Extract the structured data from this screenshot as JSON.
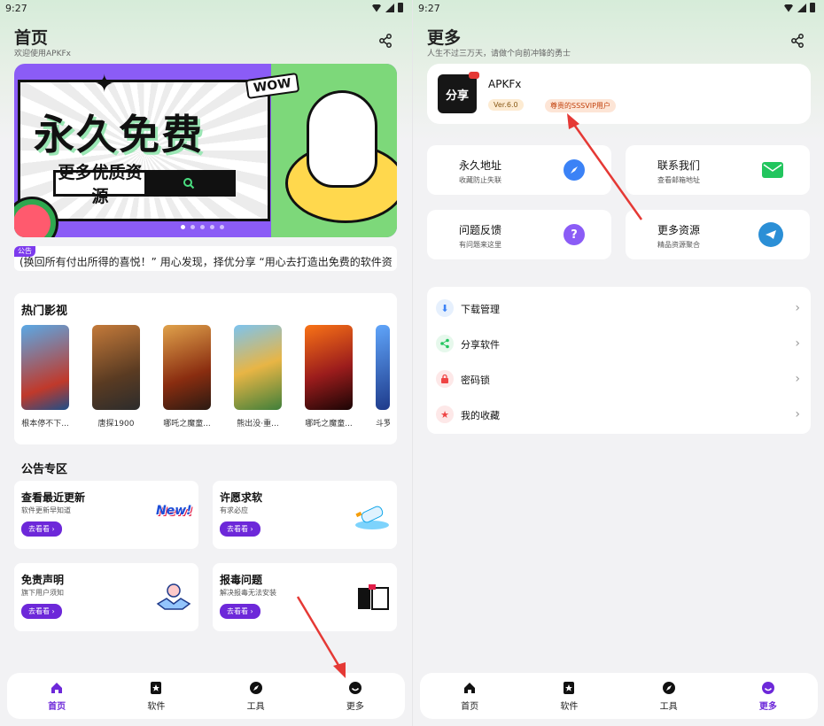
{
  "left_screen": {
    "status": {
      "time": "9:27"
    },
    "header": {
      "title": "首页",
      "subtitle": "欢迎使用APKFx"
    },
    "banner": {
      "title": "永久免费",
      "search_text": "更多优质资源",
      "wow": "WOW",
      "dots": 5,
      "active_dot": 0
    },
    "notice": {
      "tag": "公告",
      "text": "(换回所有付出所得的喜悦！” 用心发现，择优分享 “用心去打造出免费的软件资"
    },
    "movies": {
      "title": "热门影视",
      "items": [
        {
          "name": "根本停不下...",
          "color": "#2b6cb0"
        },
        {
          "name": "唐探1900",
          "color": "#a0522d"
        },
        {
          "name": "哪吒之魔童...",
          "color": "#7c2d12"
        },
        {
          "name": "熊出没·重...",
          "color": "#2f855a"
        },
        {
          "name": "哪吒之魔童...",
          "color": "#9b1c1c"
        },
        {
          "name": "斗罗",
          "color": "#1e3a8a"
        }
      ]
    },
    "notice_zone": {
      "title": "公告专区",
      "cards": [
        {
          "title": "查看最近更新",
          "sub": "软件更新早知道",
          "btn": "去看看"
        },
        {
          "title": "许愿求软",
          "sub": "有求必应",
          "btn": "去看看"
        },
        {
          "title": "免责声明",
          "sub": "旗下用户须知",
          "btn": "去看看"
        },
        {
          "title": "报毒问题",
          "sub": "解决报毒无法安装",
          "btn": "去看看"
        }
      ],
      "art_text": {
        "new": "New!"
      }
    },
    "tabbar": [
      {
        "label": "首页",
        "icon": "home-icon",
        "active": true
      },
      {
        "label": "软件",
        "icon": "star-icon",
        "active": false
      },
      {
        "label": "工具",
        "icon": "compass-icon",
        "active": false
      },
      {
        "label": "更多",
        "icon": "more-icon",
        "active": false
      }
    ]
  },
  "right_screen": {
    "status": {
      "time": "9:27"
    },
    "header": {
      "title": "更多",
      "subtitle": "人生不过三万天，请做个向前冲锋的勇士"
    },
    "profile": {
      "logo_text": "分享",
      "name": "APKFx",
      "version": "Ver.6.0",
      "vip": "尊贵的SSSVIP用户"
    },
    "grid": [
      {
        "title": "永久地址",
        "sub": "收藏防止失联",
        "icon": "compass-icon",
        "color": "#3b82f6"
      },
      {
        "title": "联系我们",
        "sub": "查看邮箱地址",
        "icon": "mail-icon",
        "color": "#22c55e"
      },
      {
        "title": "问题反馈",
        "sub": "有问题来这里",
        "icon": "chat-question-icon",
        "color": "#8b5cf6"
      },
      {
        "title": "更多资源",
        "sub": "精品资源聚合",
        "icon": "telegram-icon",
        "color": "#2b8fd6"
      }
    ],
    "menu": [
      {
        "label": "下载管理",
        "icon": "download-icon",
        "color": "#3b82f6",
        "bg": "#e6f0fd"
      },
      {
        "label": "分享软件",
        "icon": "share-icon",
        "color": "#22c55e",
        "bg": "#e6f8ec"
      },
      {
        "label": "密码锁",
        "icon": "lock-icon",
        "color": "#ef4444",
        "bg": "#fde8e8"
      },
      {
        "label": "我的收藏",
        "icon": "star-icon",
        "color": "#ef4444",
        "bg": "#fde8e8"
      }
    ],
    "tabbar": [
      {
        "label": "首页",
        "icon": "home-icon",
        "active": false
      },
      {
        "label": "软件",
        "icon": "star-icon",
        "active": false
      },
      {
        "label": "工具",
        "icon": "compass-icon",
        "active": false
      },
      {
        "label": "更多",
        "icon": "more-icon",
        "active": true
      }
    ]
  },
  "colors": {
    "accent": "#6d28d9",
    "arrow": "#e53935"
  }
}
